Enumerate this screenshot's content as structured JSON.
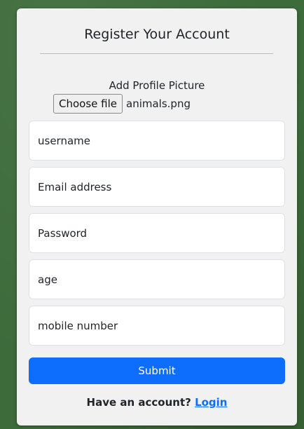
{
  "colors": {
    "page_background": "#3d6b3a",
    "card_background": "#f1f1f1",
    "submit_accent": "#0d6efd",
    "link": "#0d6efd"
  },
  "form": {
    "title": "Register Your Account",
    "profile_picture": {
      "label": "Add Profile Picture",
      "button_label": "Choose file",
      "selected_file": "animals.png"
    },
    "fields": {
      "username_placeholder": "username",
      "email_placeholder": "Email address",
      "password_placeholder": "Password",
      "age_placeholder": "age",
      "mobile_placeholder": "mobile number"
    },
    "submit_label": "Submit",
    "footer": {
      "prompt": "Have an account?",
      "login_link": "Login"
    }
  }
}
